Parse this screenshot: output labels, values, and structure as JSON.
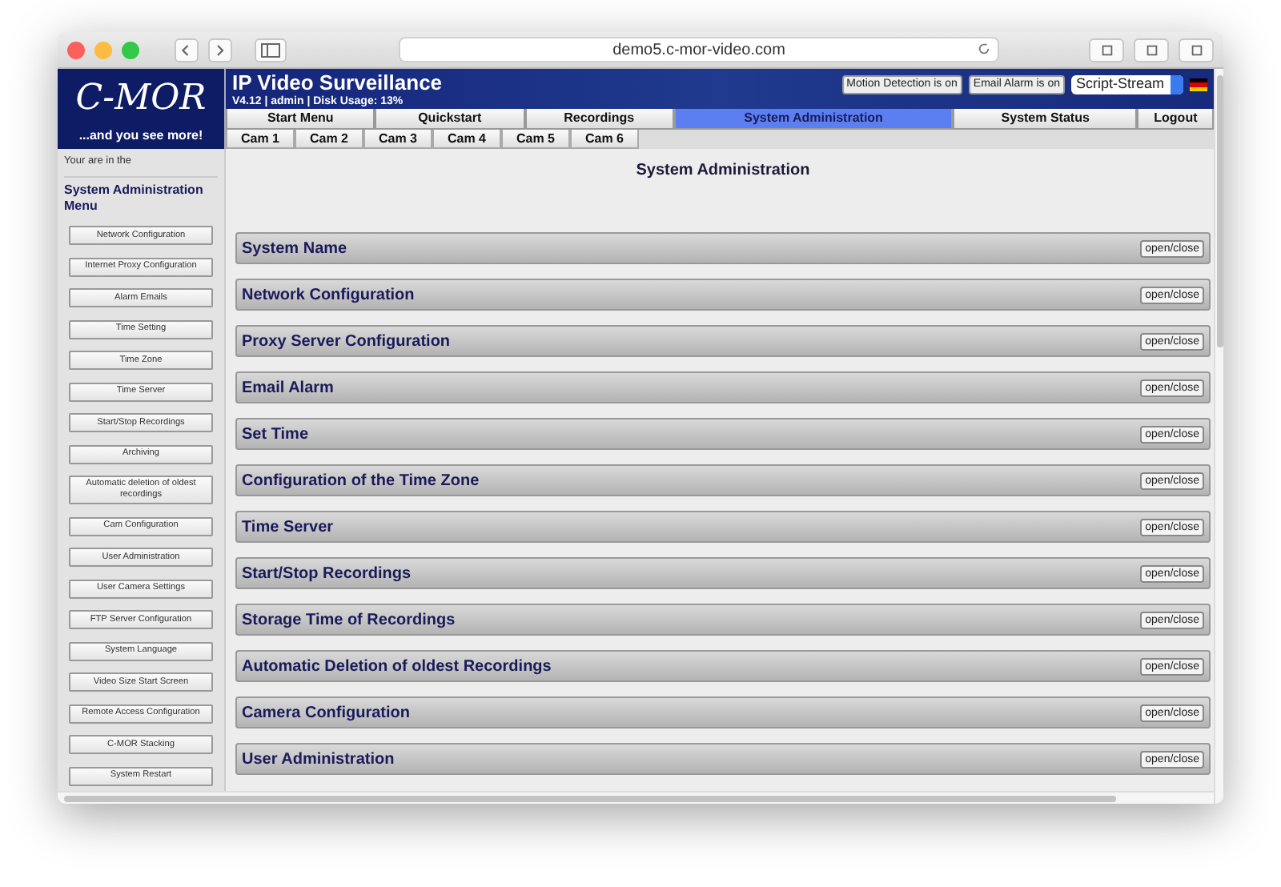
{
  "browser": {
    "url": "demo5.c-mor-video.com"
  },
  "header": {
    "logo": "C-MOR",
    "slogan": "...and you see more!",
    "title": "IP Video Surveillance",
    "info": "V4.12 | admin | Disk Usage: 13%",
    "status_buttons": [
      "Motion Detection is on",
      "Email Alarm is on"
    ],
    "stream_select": "Script-Stream"
  },
  "tabs": [
    {
      "label": "Start Menu",
      "selected": false
    },
    {
      "label": "Quickstart",
      "selected": false
    },
    {
      "label": "Recordings",
      "selected": false
    },
    {
      "label": "System Administration",
      "selected": true
    },
    {
      "label": "System Status",
      "selected": false
    },
    {
      "label": "Logout",
      "selected": false
    }
  ],
  "cam_tabs": [
    "Cam 1",
    "Cam 2",
    "Cam 3",
    "Cam 4",
    "Cam 5",
    "Cam 6"
  ],
  "sidebar": {
    "intro": "Your are in the",
    "heading": "System Administration Menu",
    "items": [
      "Network Configuration",
      "Internet Proxy Configuration",
      "Alarm Emails",
      "Time Setting",
      "Time Zone",
      "Time Server",
      "Start/Stop Recordings",
      "Archiving",
      "Automatic deletion of oldest recordings",
      "Cam Configuration",
      "User Administration",
      "User Camera Settings",
      "FTP Server Configuration",
      "System Language",
      "Video Size Start Screen",
      "Remote Access Configuration",
      "C-MOR Stacking",
      "System Restart"
    ]
  },
  "main": {
    "title": "System Administration",
    "sections": [
      {
        "title": "System Name",
        "button": "open/close"
      },
      {
        "title": "Network Configuration",
        "button": "open/close"
      },
      {
        "title": "Proxy Server Configuration",
        "button": "open/close"
      },
      {
        "title": "Email Alarm",
        "button": "open/close"
      },
      {
        "title": "Set Time",
        "button": "open/close"
      },
      {
        "title": "Configuration of the Time Zone",
        "button": "open/close"
      },
      {
        "title": "Time Server",
        "button": "open/close"
      },
      {
        "title": "Start/Stop Recordings",
        "button": "open/close"
      },
      {
        "title": "Storage Time of Recordings",
        "button": "open/close"
      },
      {
        "title": "Automatic Deletion of oldest Recordings",
        "button": "open/close"
      },
      {
        "title": "Camera Configuration",
        "button": "open/close"
      },
      {
        "title": "User Administration",
        "button": "open/close"
      }
    ]
  }
}
